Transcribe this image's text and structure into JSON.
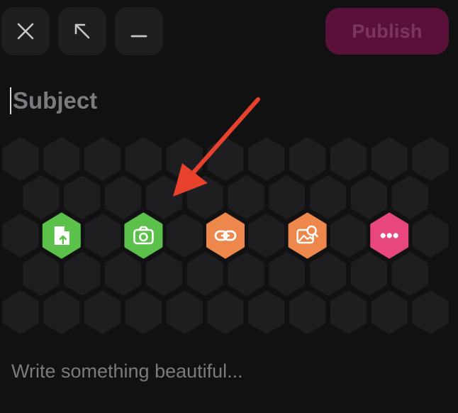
{
  "toolbar": {
    "close_icon": "close-icon",
    "popout_icon": "arrow-up-left-icon",
    "minimize_icon": "minimize-icon",
    "publish_label": "Publish"
  },
  "editor": {
    "subject_placeholder": "Subject",
    "body_placeholder": "Write something beautiful..."
  },
  "post_types": [
    {
      "icon": "file-upload-icon",
      "color": "#5cc14a",
      "name": "upload-file"
    },
    {
      "icon": "camera-icon",
      "color": "#5cc14a",
      "name": "photo"
    },
    {
      "icon": "link-icon",
      "color": "#ee874c",
      "name": "link"
    },
    {
      "icon": "image-search-icon",
      "color": "#ee874c",
      "name": "image-search"
    },
    {
      "icon": "more-icon",
      "color": "#e8467f",
      "name": "more"
    }
  ],
  "colors": {
    "background": "#111112",
    "hex_cell": "#1e1e20",
    "publish_bg": "#5a1139",
    "publish_text": "#7a3560",
    "annotation_arrow": "#e8412c"
  }
}
